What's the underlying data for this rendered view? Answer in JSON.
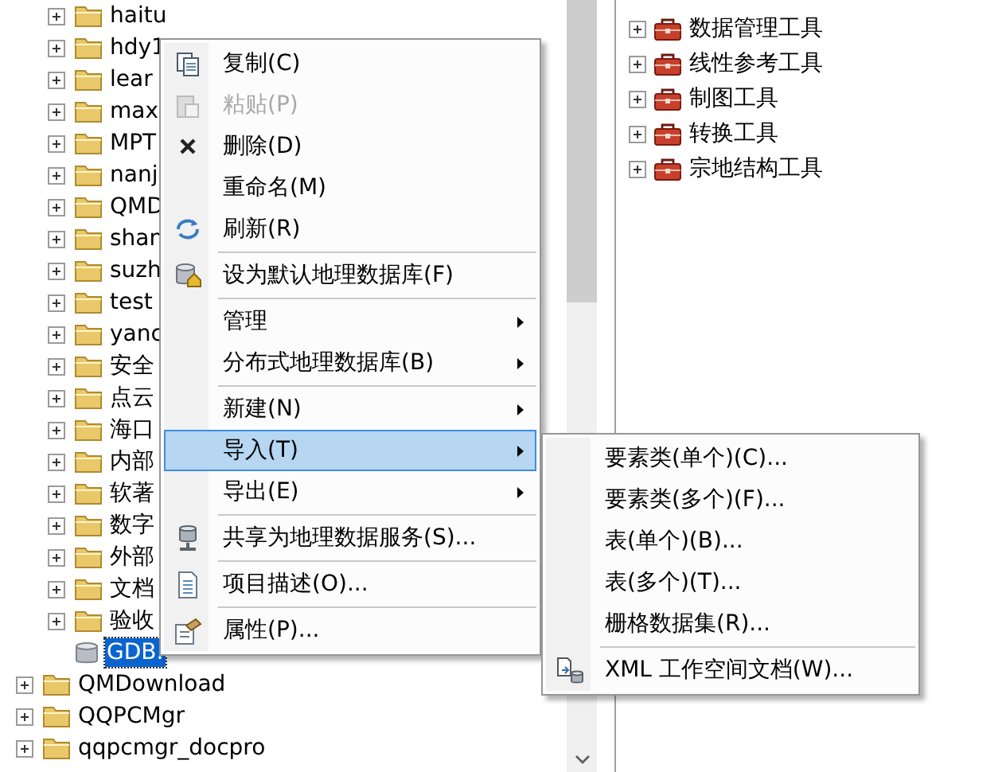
{
  "left_tree": [
    {
      "children": [
        {
          "label": "haitu",
          "kind": "folder",
          "expanded": false,
          "selected": false
        },
        {
          "label": "hdy1",
          "kind": "folder",
          "expanded": false,
          "selected": false
        },
        {
          "label": "lear",
          "kind": "folder",
          "expanded": false,
          "selected": false
        },
        {
          "label": "max",
          "kind": "folder",
          "expanded": false,
          "selected": false
        },
        {
          "label": "MPT",
          "kind": "folder",
          "expanded": false,
          "selected": false
        },
        {
          "label": "nanj",
          "kind": "folder",
          "expanded": false,
          "selected": false
        },
        {
          "label": "QMD",
          "kind": "folder",
          "expanded": false,
          "selected": false
        },
        {
          "label": "shan",
          "kind": "folder",
          "expanded": false,
          "selected": false
        },
        {
          "label": "suzh",
          "kind": "folder",
          "expanded": false,
          "selected": false
        },
        {
          "label": "test",
          "kind": "folder",
          "expanded": false,
          "selected": false
        },
        {
          "label": "yanc",
          "kind": "folder",
          "expanded": false,
          "selected": false
        },
        {
          "label": "安全",
          "kind": "folder",
          "expanded": false,
          "selected": false
        },
        {
          "label": "点云",
          "kind": "folder",
          "expanded": false,
          "selected": false
        },
        {
          "label": "海口",
          "kind": "folder",
          "expanded": false,
          "selected": false
        },
        {
          "label": "内部",
          "kind": "folder",
          "expanded": false,
          "selected": false
        },
        {
          "label": "软著",
          "kind": "folder",
          "expanded": false,
          "selected": false
        },
        {
          "label": "数字",
          "kind": "folder",
          "expanded": false,
          "selected": false
        },
        {
          "label": "外部",
          "kind": "folder",
          "expanded": false,
          "selected": false
        },
        {
          "label": "文档",
          "kind": "folder",
          "expanded": false,
          "selected": false
        },
        {
          "label": "验收",
          "kind": "folder",
          "expanded": false,
          "selected": false
        },
        {
          "label": "GDB.",
          "kind": "database",
          "selected": true
        }
      ]
    },
    {
      "label": "QMDownload",
      "kind": "folder",
      "expanded": false,
      "selected": false
    },
    {
      "label": "QQPCMgr",
      "kind": "folder",
      "expanded": false,
      "selected": false
    },
    {
      "label": "qqpcmgr_docpro",
      "kind": "folder",
      "expanded": false,
      "selected": false
    }
  ],
  "right_tree": [
    {
      "label": "数据管理工具",
      "expanded": false
    },
    {
      "label": "线性参考工具",
      "expanded": false
    },
    {
      "label": "制图工具",
      "expanded": false
    },
    {
      "label": "转换工具",
      "expanded": false
    },
    {
      "label": "宗地结构工具",
      "expanded": false
    }
  ],
  "context_menu": [
    {
      "kind": "item",
      "label": "复制(C)",
      "disabled": false,
      "submenu": false,
      "selected": false
    },
    {
      "kind": "item",
      "label": "粘贴(P)",
      "disabled": true,
      "submenu": false,
      "selected": false
    },
    {
      "kind": "item",
      "label": "删除(D)",
      "disabled": false,
      "submenu": false,
      "selected": false
    },
    {
      "kind": "item",
      "label": "重命名(M)",
      "disabled": false,
      "submenu": false,
      "selected": false
    },
    {
      "kind": "item",
      "label": "刷新(R)",
      "disabled": false,
      "submenu": false,
      "selected": false
    },
    {
      "kind": "separator"
    },
    {
      "kind": "item",
      "label": "设为默认地理数据库(F)",
      "disabled": false,
      "submenu": false,
      "selected": false
    },
    {
      "kind": "separator"
    },
    {
      "kind": "item",
      "label": "管理",
      "disabled": false,
      "submenu": true,
      "selected": false
    },
    {
      "kind": "item",
      "label": "分布式地理数据库(B)",
      "disabled": false,
      "submenu": true,
      "selected": false
    },
    {
      "kind": "separator"
    },
    {
      "kind": "item",
      "label": "新建(N)",
      "disabled": false,
      "submenu": true,
      "selected": false
    },
    {
      "kind": "item",
      "label": "导入(T)",
      "disabled": false,
      "submenu": true,
      "selected": true
    },
    {
      "kind": "item",
      "label": "导出(E)",
      "disabled": false,
      "submenu": true,
      "selected": false
    },
    {
      "kind": "separator"
    },
    {
      "kind": "item",
      "label": "共享为地理数据服务(S)...",
      "disabled": false,
      "submenu": false,
      "selected": false
    },
    {
      "kind": "separator"
    },
    {
      "kind": "item",
      "label": "项目描述(O)...",
      "disabled": false,
      "submenu": false,
      "selected": false
    },
    {
      "kind": "separator"
    },
    {
      "kind": "item",
      "label": "属性(P)...",
      "disabled": false,
      "submenu": false,
      "selected": false
    }
  ],
  "import_submenu": [
    {
      "kind": "item",
      "label": "要素类(单个)(C)..."
    },
    {
      "kind": "item",
      "label": "要素类(多个)(F)..."
    },
    {
      "kind": "item",
      "label": "表(单个)(B)..."
    },
    {
      "kind": "item",
      "label": "表(多个)(T)..."
    },
    {
      "kind": "item",
      "label": "栅格数据集(R)..."
    },
    {
      "kind": "separator"
    },
    {
      "kind": "item",
      "label": "XML 工作空间文档(W)..."
    }
  ]
}
